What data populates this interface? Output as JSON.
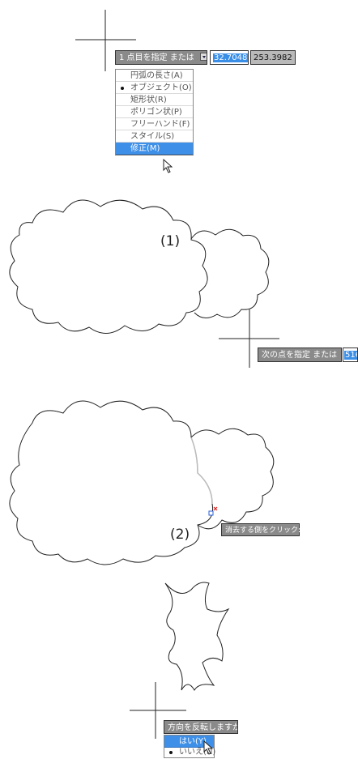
{
  "panel1": {
    "prompt": "1 点目を指定 または",
    "x_value": "32.7048",
    "y_value": "253.3982",
    "menu": [
      {
        "label": "円弧の長さ(A)",
        "selected": false,
        "highlighted": false
      },
      {
        "label": "オブジェクト(O)",
        "selected": true,
        "highlighted": false
      },
      {
        "label": "矩形状(R)",
        "selected": false,
        "highlighted": false
      },
      {
        "label": "ポリゴン状(P)",
        "selected": false,
        "highlighted": false
      },
      {
        "label": "フリーハンド(F)",
        "selected": false,
        "highlighted": false
      },
      {
        "label": "スタイル(S)",
        "selected": false,
        "highlighted": false
      },
      {
        "label": "修正(M)",
        "selected": false,
        "highlighted": true
      }
    ]
  },
  "panel2": {
    "step_label": "(1)",
    "prompt": "次の点を指定 または",
    "value_partial": "516"
  },
  "panel3": {
    "step_label": "(2)",
    "tooltip": "消去する側をクリック:"
  },
  "panel4": {
    "prompt": "方向を反転しますか?",
    "menu": [
      {
        "label": "はい(Y)",
        "selected": false,
        "highlighted": true
      },
      {
        "label": "いいえ(N)",
        "selected": true,
        "highlighted": false
      }
    ]
  },
  "colors": {
    "prompt_bg": "#8a8a8a",
    "highlight": "#3d8fe8",
    "marker_red": "#e02020"
  }
}
